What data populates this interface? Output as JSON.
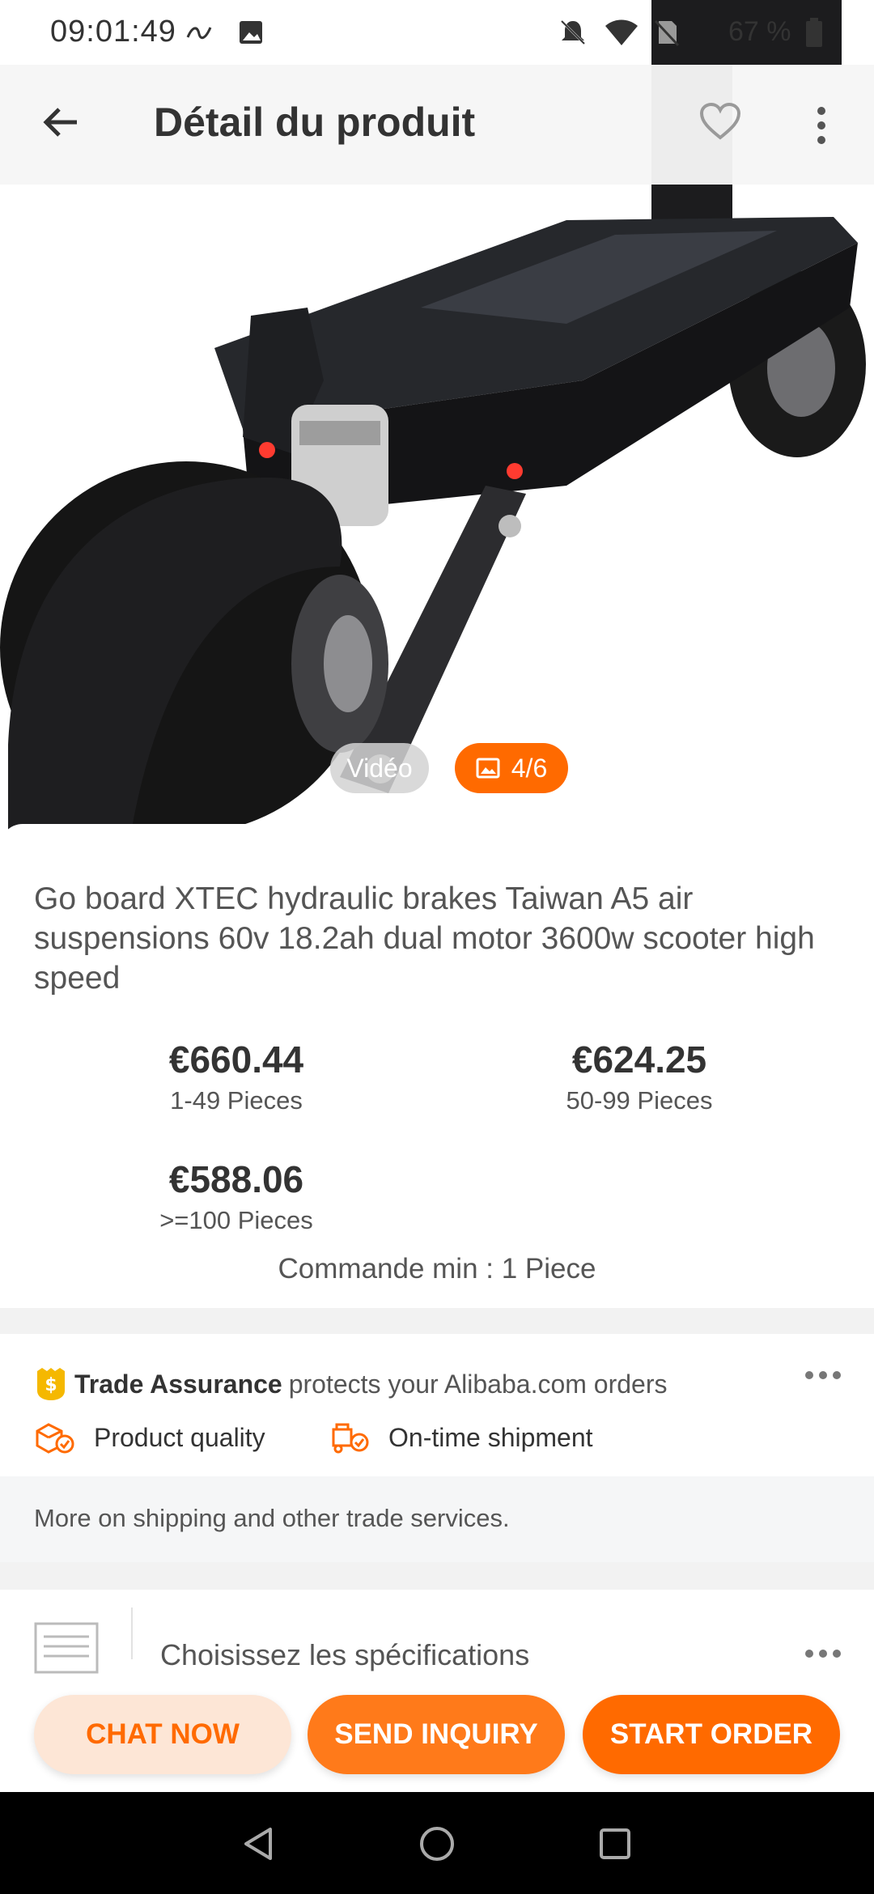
{
  "status_bar": {
    "time": "09:01:49",
    "battery": "67 %",
    "icons": [
      "link-icon",
      "image-icon",
      "bell-off-icon",
      "wifi-icon",
      "no-sim-icon",
      "battery-icon"
    ]
  },
  "app_bar": {
    "title": "Détail du produit",
    "back_icon": "arrow-left-icon",
    "favorite_icon": "heart-outline-icon",
    "more_icon": "more-vertical-icon"
  },
  "media": {
    "video_label": "Vidéo",
    "gallery_counter": "4/6",
    "gallery_icon": "image-icon"
  },
  "product": {
    "title": "Go board XTEC hydraulic brakes  Taiwan A5 air suspensions 60v 18.2ah dual motor 3600w scooter high speed",
    "prices": [
      {
        "value": "€660.44",
        "qty": "1-49 Pieces"
      },
      {
        "value": "€624.25",
        "qty": "50-99 Pieces"
      },
      {
        "value": "€588.06",
        "qty": ">=100 Pieces"
      }
    ],
    "min_order": "Commande min : 1 Piece"
  },
  "trade_assurance": {
    "brand": "Trade Assurance",
    "description": "protects your Alibaba.com orders",
    "features": [
      {
        "label": "Product quality",
        "icon": "product-quality-icon"
      },
      {
        "label": "On-time shipment",
        "icon": "on-time-shipment-icon"
      }
    ],
    "more_icon": "more-horizontal-icon",
    "accent_color": "#ff6a00",
    "badge_color": "#f5b800"
  },
  "shipping": {
    "text": "More on shipping and other trade services."
  },
  "specifications": {
    "label": "Choisissez les spécifications",
    "icon": "list-icon"
  },
  "actions": {
    "chat": "CHAT NOW",
    "inquiry": "SEND INQUIRY",
    "order": "START ORDER"
  },
  "nav_bar": {
    "icons": [
      "nav-back-icon",
      "nav-home-icon",
      "nav-recents-icon"
    ]
  },
  "colors": {
    "accent": "#ff6a00",
    "chat_bg": "#fde6d6"
  }
}
